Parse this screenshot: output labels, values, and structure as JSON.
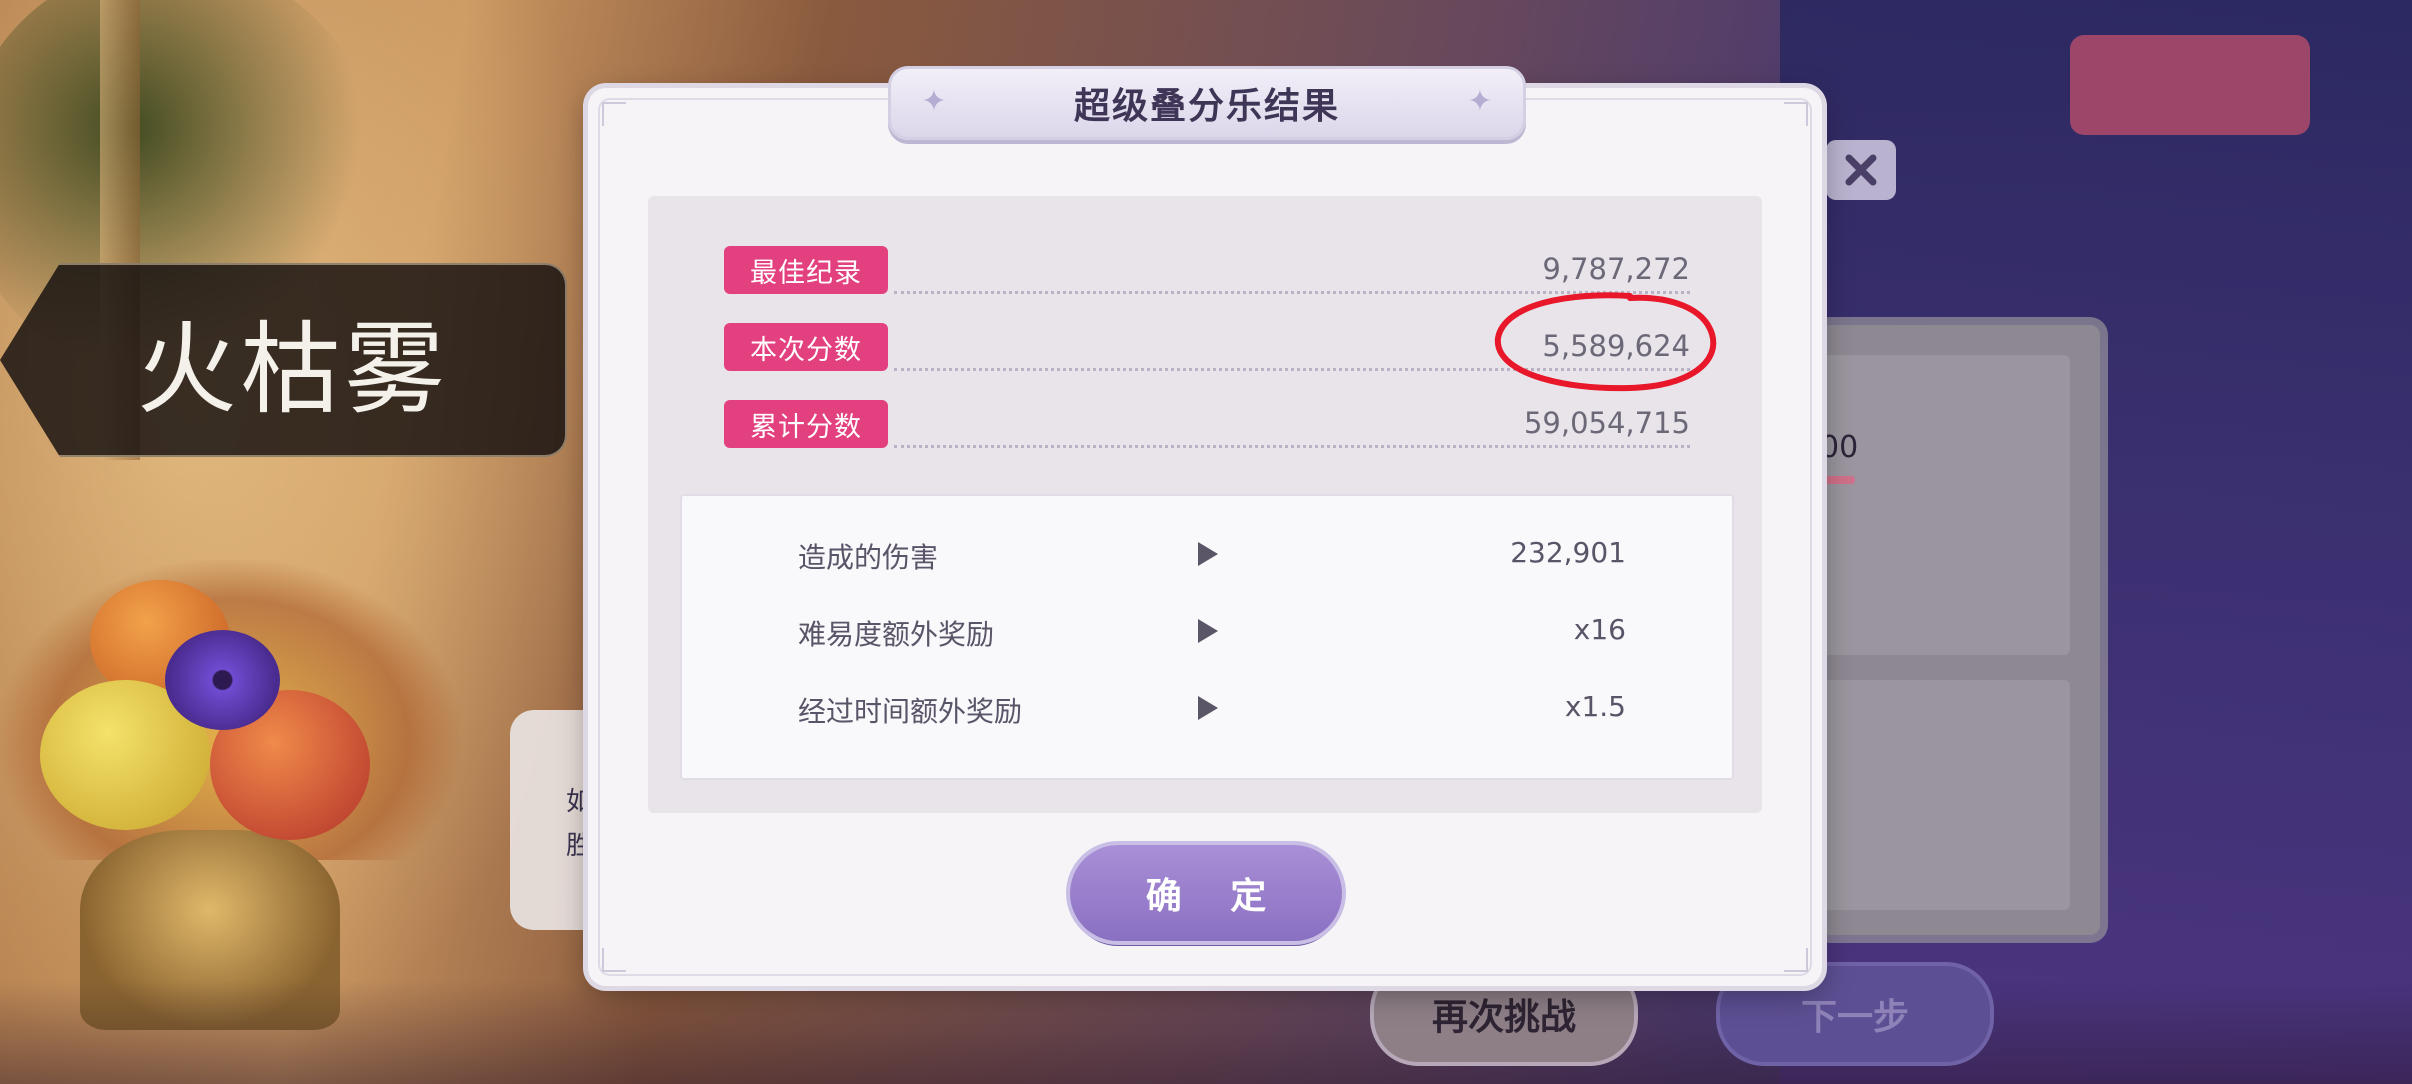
{
  "character_name": "火枯雾",
  "modal": {
    "title": "超级叠分乐结果",
    "scores": [
      {
        "label": "最佳纪录",
        "value": "9,787,272"
      },
      {
        "label": "本次分数",
        "value": "5,589,624"
      },
      {
        "label": "累计分数",
        "value": "59,054,715"
      }
    ],
    "details": [
      {
        "label": "造成的伤害",
        "value": "232,901"
      },
      {
        "label": "难易度额外奖励",
        "value": "x16"
      },
      {
        "label": "经过时间额外奖励",
        "value": "x1.5"
      }
    ],
    "confirm_label": "确 定"
  },
  "background": {
    "retry_label": "再次挑战",
    "next_label": "下一步",
    "side_panel_value": "00",
    "dialog_text_1": "如",
    "dialog_text_2": "胜"
  },
  "icons": {
    "close": "close-icon",
    "sparkle": "sparkle-icon",
    "arrow": "play-arrow-icon"
  },
  "colors": {
    "label_pink": "#e2407e",
    "confirm_purple": "#9a80cc",
    "annotation_red": "#e8182a"
  }
}
